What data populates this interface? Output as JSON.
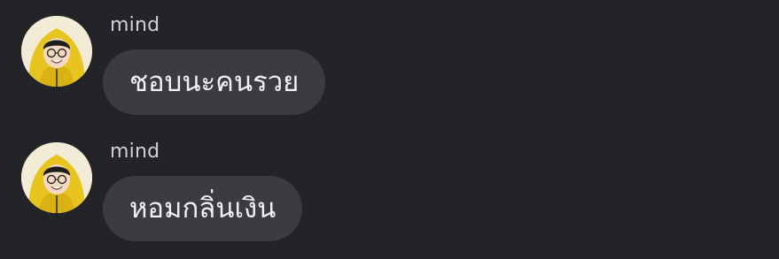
{
  "messages": [
    {
      "sender": "mind",
      "avatar_icon": "user-avatar-yellow-hoodie",
      "text": "ชอบนะคนรวย"
    },
    {
      "sender": "mind",
      "avatar_icon": "user-avatar-yellow-hoodie",
      "text": "หอมกลิ่นเงิน"
    }
  ],
  "colors": {
    "background": "#232428",
    "bubble": "#3b3c41",
    "bubble_text": "#f1f1f3",
    "sender_text": "#cfd1d6",
    "hoodie": "#e8c41f"
  }
}
